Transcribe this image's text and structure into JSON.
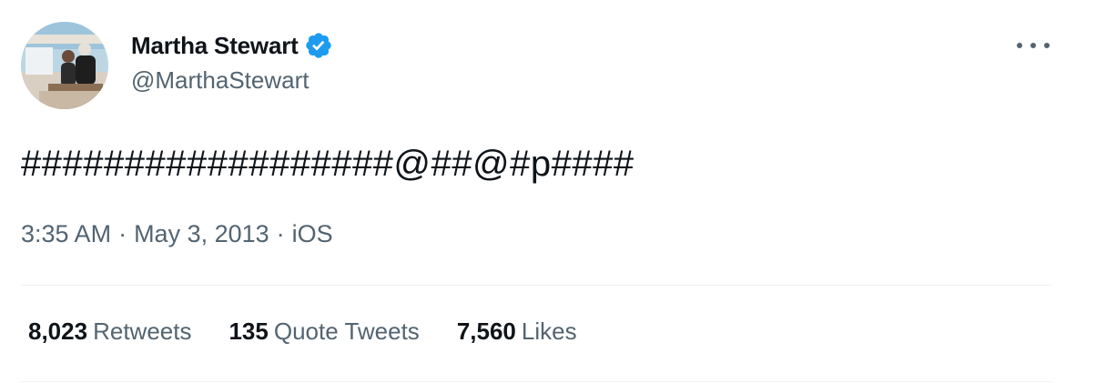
{
  "author": {
    "display_name": "Martha Stewart",
    "handle": "@MarthaStewart",
    "verified": true,
    "verified_color": "#1d9bf0"
  },
  "tweet": {
    "text": "##################@##@#p####"
  },
  "meta": {
    "time": "3:35 AM",
    "separator": "·",
    "date": "May 3, 2013",
    "source": "iOS"
  },
  "stats": {
    "retweets_count": "8,023",
    "retweets_label": "Retweets",
    "quotes_count": "135",
    "quotes_label": "Quote Tweets",
    "likes_count": "7,560",
    "likes_label": "Likes"
  },
  "icons": {
    "verified": "verified-badge-icon",
    "more": "more-options-icon"
  },
  "colors": {
    "text_primary": "#0f1419",
    "text_secondary": "#536471",
    "divider": "#eff3f4"
  }
}
